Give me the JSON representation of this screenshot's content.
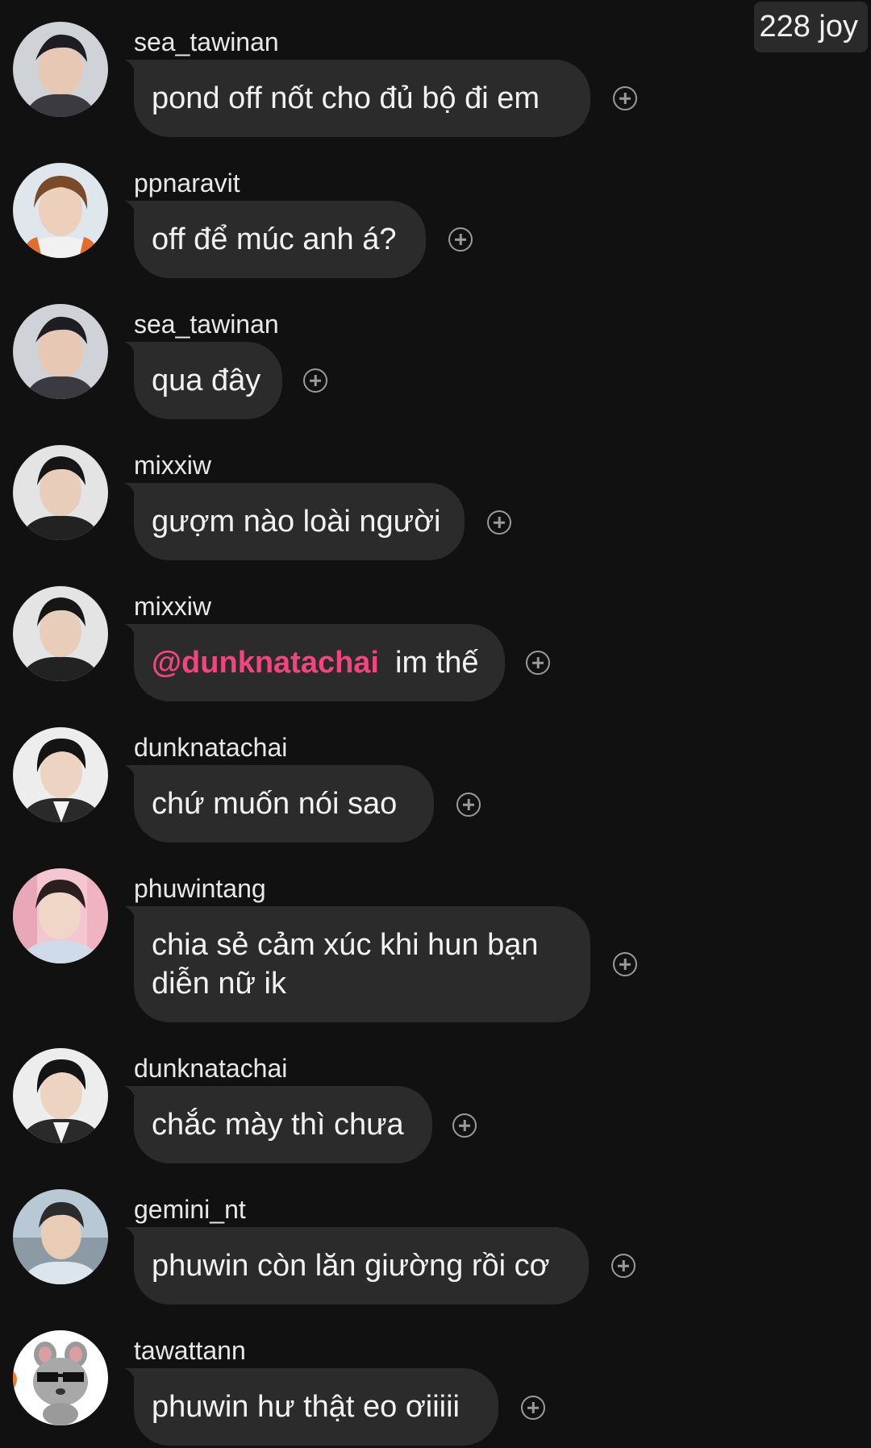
{
  "header": {
    "badge": "228 joy"
  },
  "messages": [
    {
      "user": "sea_tawinan",
      "mention": "",
      "text": "pond off nốt cho đủ bộ đi em"
    },
    {
      "user": "ppnaravit",
      "mention": "",
      "text": "off để múc anh á?"
    },
    {
      "user": "sea_tawinan",
      "mention": "",
      "text": "qua đây"
    },
    {
      "user": "mixxiw",
      "mention": "",
      "text": "gượm nào loài người"
    },
    {
      "user": "mixxiw",
      "mention": "@dunknatachai",
      "text": "im thế"
    },
    {
      "user": "dunknatachai",
      "mention": "",
      "text": "chứ muốn nói sao"
    },
    {
      "user": "phuwintang",
      "mention": "",
      "text": "chia sẻ cảm xúc khi hun bạn diễn nữ ik"
    },
    {
      "user": "dunknatachai",
      "mention": "",
      "text": "chắc mày thì chưa"
    },
    {
      "user": "gemini_nt",
      "mention": "",
      "text": "phuwin còn lăn giường rồi cơ"
    },
    {
      "user": "tawattann",
      "mention": "",
      "text": "phuwin hư thật eo ơiiiii"
    }
  ],
  "colors": {
    "background": "#111111",
    "bubble": "#2b2b2b",
    "mention": "#f0457e",
    "text": "#f2f2f2"
  },
  "icons": {
    "react": "add-reaction-icon",
    "avatar": "user-avatar"
  }
}
